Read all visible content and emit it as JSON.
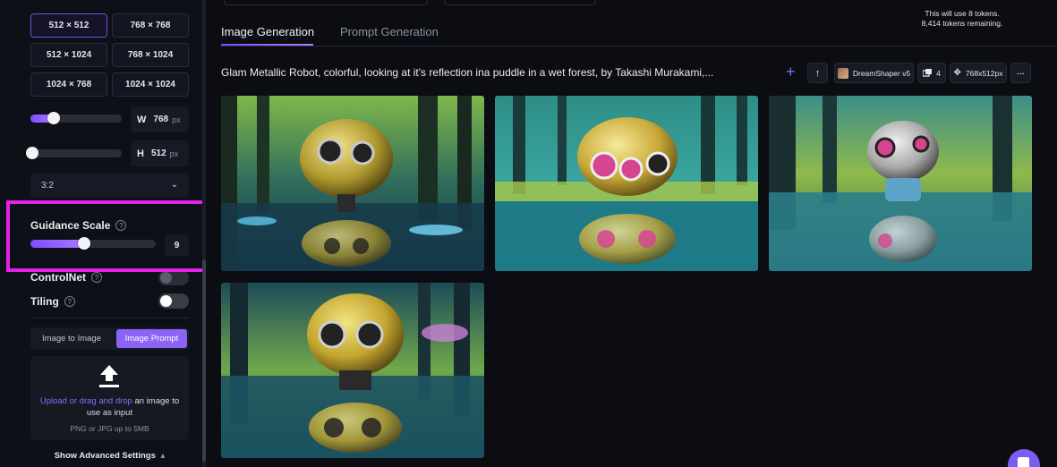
{
  "sidebar": {
    "sizes": [
      "512 × 512",
      "768 × 768",
      "512 × 1024",
      "768 × 1024",
      "1024 × 768",
      "1024 × 1024"
    ],
    "width": {
      "letter": "W",
      "value": "768",
      "unit": "px",
      "level": 0.25
    },
    "height": {
      "letter": "H",
      "value": "512",
      "unit": "px",
      "level": 0.0
    },
    "aspect_ratio": "3:2",
    "guidance_scale": {
      "label": "Guidance Scale",
      "help": "?",
      "value": "9",
      "level": 0.42
    },
    "controlnet": {
      "label": "ControlNet",
      "help": "?",
      "enabled": false
    },
    "tiling": {
      "label": "Tiling",
      "help": "?",
      "enabled": true
    },
    "mode_tabs": [
      "Image to Image",
      "Image Prompt"
    ],
    "upload": {
      "link": "Upload or drag and drop",
      "rest": " an image to use as input",
      "sub": "PNG or JPG up to 5MB"
    },
    "advanced": "Show Advanced Settings",
    "advanced_chevron": "▴"
  },
  "main": {
    "tabs": [
      "Image Generation",
      "Prompt Generation"
    ],
    "token_info": [
      "This will use 8 tokens.",
      "8,414 tokens remaining."
    ],
    "prompt": "Glam Metallic Robot, colorful, looking at it's reflection ina puddle in a wet forest, by Takashi Murakami,...",
    "toolbar": {
      "model": "DreamShaper v5",
      "count": "4",
      "dimensions": "768x512px",
      "more": "···",
      "upload_arrow": "↑"
    }
  },
  "colors": {
    "accent": "#7c4dff",
    "highlight": "#e620e6",
    "background": "#0b0d13"
  },
  "icons": [
    "chevron-down-icon",
    "help-icon",
    "upload-arrow-icon",
    "plus-icon",
    "model-thumb-icon",
    "images-icon",
    "resize-icon",
    "more-icon",
    "chat-icon"
  ]
}
